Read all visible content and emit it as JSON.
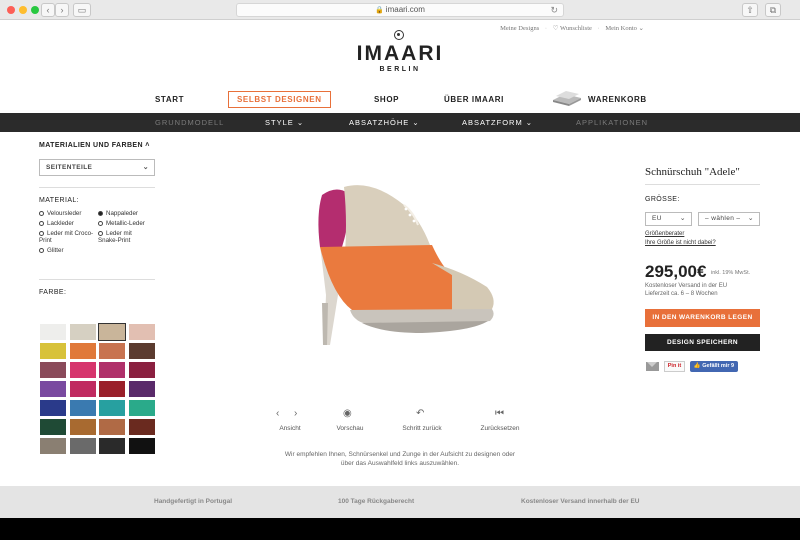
{
  "browser": {
    "url": "imaari.com"
  },
  "toplinks": [
    "Meine Designs",
    "♡ Wunschliste",
    "Mein Konto ⌄"
  ],
  "brand": {
    "name": "IMAARI",
    "city": "BERLIN"
  },
  "mainnav": {
    "start": "START",
    "selbst": "SELBST DESIGNEN",
    "shop": "SHOP",
    "ueber": "ÜBER IMAARI",
    "cart": "WARENKORB"
  },
  "subnav": {
    "grundmodell": "GRUNDMODELL",
    "style": "STYLE ⌄",
    "absatzhoehe": "ABSATZHÖHE ⌄",
    "absatzform": "ABSATZFORM ⌄",
    "applikationen": "APPLIKATIONEN"
  },
  "left": {
    "materials_header": "MATERIALIEN UND FARBEN ˄",
    "part_select": "SEITENTEILE",
    "material_label": "MATERIAL:",
    "materials": [
      {
        "label": "Veloursleder",
        "selected": false
      },
      {
        "label": "Nappaleder",
        "selected": true
      },
      {
        "label": "Lackleder",
        "selected": false
      },
      {
        "label": "Metallic-Leder",
        "selected": false
      },
      {
        "label": "Leder mit Croco-Print",
        "selected": false
      },
      {
        "label": "Leder mit Snake-Print",
        "selected": false
      },
      {
        "label": "Glitter",
        "selected": false
      }
    ],
    "farbe_label": "FARBE:",
    "swatches": [
      "#eeeeec",
      "#d6d0c2",
      "#c9b59a",
      "#e2bfb2",
      "#d8c23a",
      "#e0793a",
      "#c87350",
      "#5b3b2f",
      "#8a4a5a",
      "#d6356d",
      "#b0306a",
      "#8a2040",
      "#7a4aa0",
      "#c02a60",
      "#9a1f2a",
      "#5a2a6a",
      "#2a3a8a",
      "#3a7ab0",
      "#27a0a0",
      "#2aaa8a",
      "#1f4a35",
      "#a86a30",
      "#b06a45",
      "#6a2a1f",
      "#8a7f72",
      "#6a6a6a",
      "#2a2a2a",
      "#111111"
    ],
    "selected_swatch": 2
  },
  "viewer": {
    "ansicht": "Ansicht",
    "vorschau": "Vorschau",
    "zurueck": "Schritt zurück",
    "reset": "Zurücksetzen",
    "hint": "Wir empfehlen Ihnen, Schnürsenkel und Zunge in der Aufsicht zu designen oder über das Auswahlfeld links auszuwählen."
  },
  "right": {
    "title": "Schnürschuh \"Adele\"",
    "size_label": "GRÖSSE:",
    "size_system": "EU",
    "size_value": "– wählen –",
    "sizing_link": "Größenberater",
    "missing_link": "Ihre Größe ist nicht dabei?",
    "price": "295,00€",
    "vat": "inkl. 19% MwSt.",
    "shipping": "Kostenloser Versand in der EU",
    "delivery": "Lieferzeit ca. 6 – 8 Wochen",
    "add_to_cart": "IN DEN WARENKORB LEGEN",
    "save_design": "DESIGN SPEICHERN",
    "pin": "Pin it",
    "fb_like": "👍 Gefällt mir 9"
  },
  "footer": {
    "portugal": "Handgefertigt in Portugal",
    "return": "100 Tage Rückgaberecht",
    "shipping": "Kostenloser Versand innerhalb der EU"
  },
  "colors": {
    "accent": "#e8703a",
    "dark": "#2b2b2b"
  }
}
